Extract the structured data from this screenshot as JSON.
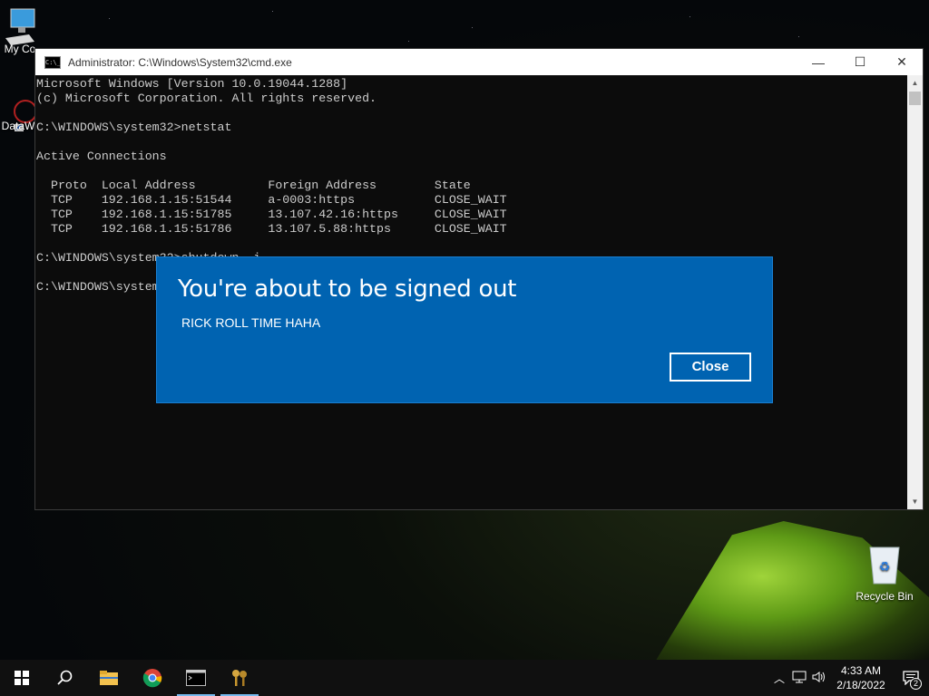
{
  "desktop": {
    "icons": [
      {
        "label": "My Co",
        "icon": "computer-icon"
      },
      {
        "label": "DataW",
        "icon": "app-shortcut-icon"
      },
      {
        "label": "Recycle Bin",
        "icon": "recycle-bin-icon"
      }
    ]
  },
  "cmd_window": {
    "title": "Administrator: C:\\Windows\\System32\\cmd.exe",
    "app_icon_text": "C:\\_",
    "controls": {
      "minimize": "—",
      "maximize": "☐",
      "close": "✕"
    },
    "lines": [
      "Microsoft Windows [Version 10.0.19044.1288]",
      "(c) Microsoft Corporation. All rights reserved.",
      "",
      "C:\\WINDOWS\\system32>netstat",
      "",
      "Active Connections",
      "",
      "  Proto  Local Address          Foreign Address        State",
      "  TCP    192.168.1.15:51544     a-0003:https           CLOSE_WAIT",
      "  TCP    192.168.1.15:51785     13.107.42.16:https     CLOSE_WAIT",
      "  TCP    192.168.1.15:51786     13.107.5.88:https      CLOSE_WAIT",
      "",
      "C:\\WINDOWS\\system32>shutdown -i",
      "",
      "C:\\WINDOWS\\system32>"
    ]
  },
  "dialog": {
    "heading": "You're about to be signed out",
    "message": "RICK ROLL TIME HAHA",
    "close_label": "Close"
  },
  "taskbar": {
    "items": [
      "start-icon",
      "search-icon",
      "file-explorer-icon",
      "chrome-icon",
      "cmd-icon",
      "keys-icon"
    ],
    "time": "4:33 AM",
    "date": "2/18/2022",
    "notification_count": "2"
  }
}
